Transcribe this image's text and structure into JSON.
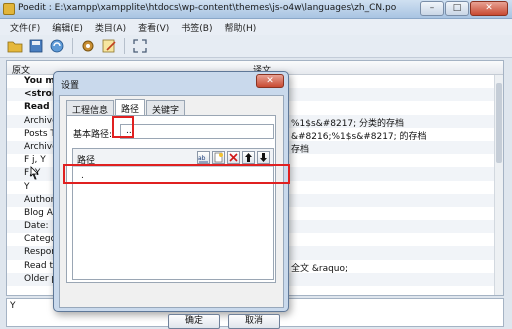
{
  "window": {
    "title": "Poedit : E:\\xampp\\xampplite\\htdocs\\wp-content\\themes\\js-o4w\\languages\\zh_CN.po",
    "min": "–",
    "max": "□",
    "close": "✕"
  },
  "menu": [
    "文件(F)",
    "编辑(E)",
    "类目(A)",
    "查看(V)",
    "书签(B)",
    "帮助(H)"
  ],
  "list": {
    "col_source": "原文",
    "col_translation": "译文",
    "rows": [
      {
        "src": "You mu",
        "tr": "",
        "bold": true
      },
      {
        "src": "<strong",
        "tr": "",
        "bold": true
      },
      {
        "src": "Read m",
        "tr": "",
        "bold": true
      },
      {
        "src": "Archive",
        "tr": "%1$s&#8217; 分类的存档",
        "bold": false
      },
      {
        "src": "Posts Ta",
        "tr": "&#8216;%1$s&#8217; 的存档",
        "bold": false
      },
      {
        "src": "Archive",
        "tr": "存档",
        "bold": false
      },
      {
        "src": "F j, Y",
        "tr": "",
        "bold": false
      },
      {
        "src": "F, Y",
        "tr": "",
        "bold": false
      },
      {
        "src": "Y",
        "tr": "",
        "bold": false
      },
      {
        "src": "Author A",
        "tr": "",
        "bold": false
      },
      {
        "src": "Blog Arc",
        "tr": "",
        "bold": false
      },
      {
        "src": "Date:",
        "tr": "",
        "bold": false
      },
      {
        "src": "Categor",
        "tr": "",
        "bold": false
      },
      {
        "src": "Respons",
        "tr": "",
        "bold": false
      },
      {
        "src": "Read the",
        "tr": "全文 &raquo;",
        "bold": false
      },
      {
        "src": "Older po",
        "tr": "",
        "bold": false
      }
    ]
  },
  "bottom_pane": {
    "text": "Y"
  },
  "dialog": {
    "title": "设置",
    "close": "✕",
    "tabs": [
      "工程信息",
      "路径",
      "关键字"
    ],
    "base_path_label": "基本路径:",
    "base_path_value": "..",
    "paths_label": "路径",
    "path_entry": ".",
    "ok": "确定",
    "cancel": "取消"
  },
  "colors": {
    "highlight": "#e02020"
  }
}
